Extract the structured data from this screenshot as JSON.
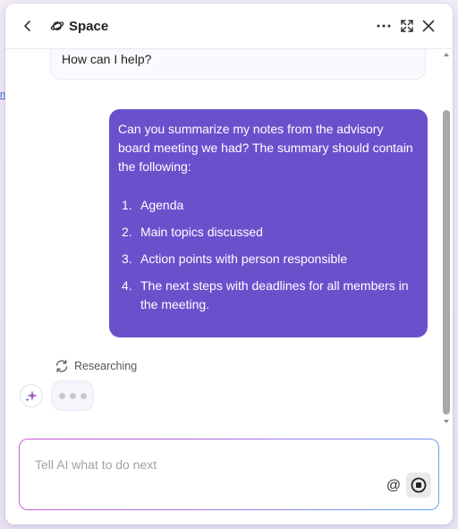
{
  "header": {
    "title": "Space",
    "back_icon": "chevron-left-icon",
    "title_icon": "planet-icon",
    "more_icon": "more-horizontal-icon",
    "expand_icon": "expand-icon",
    "close_icon": "close-icon"
  },
  "background": {
    "link_fragment": "n"
  },
  "messages": {
    "ai_greeting": "How can I help?",
    "user_intro": "Can you summarize my notes from the advisory board meeting we had? The summary should contain the following:",
    "user_list": [
      {
        "num": "1.",
        "text": "Agenda"
      },
      {
        "num": "2.",
        "text": "Main topics discussed"
      },
      {
        "num": "3.",
        "text": "Action points with person responsible"
      },
      {
        "num": "4.",
        "text": "The next steps with deadlines for all members in the meeting."
      }
    ]
  },
  "status": {
    "researching_label": "Researching",
    "refresh_icon": "refresh-icon",
    "ai_avatar_icon": "sparkle-icon",
    "typing_indicator": "typing-dots"
  },
  "composer": {
    "placeholder": "Tell AI what to do next",
    "value": "",
    "mention_label": "@",
    "stop_icon": "stop-icon"
  },
  "colors": {
    "user_bubble": "#6a51cc",
    "accent_gradient_start": "#d155d8",
    "accent_gradient_end": "#5fa8f5"
  }
}
